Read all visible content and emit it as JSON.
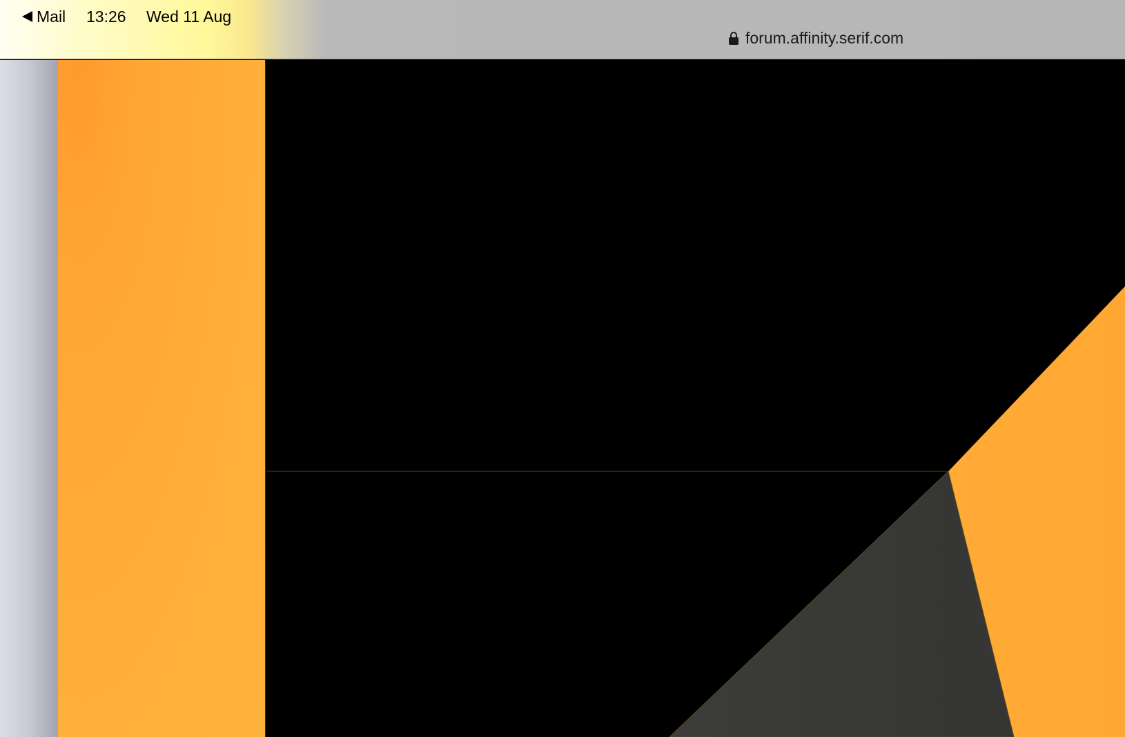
{
  "status_bar": {
    "back_label": "Mail",
    "time": "13:26",
    "date": "Wed 11 Aug"
  },
  "browser": {
    "url": "forum.affinity.serif.com",
    "lock_icon": "lock-icon"
  },
  "colors": {
    "accent_orange": "#FFA834",
    "dark_gray": "#3A3A38",
    "background": "#000000"
  }
}
